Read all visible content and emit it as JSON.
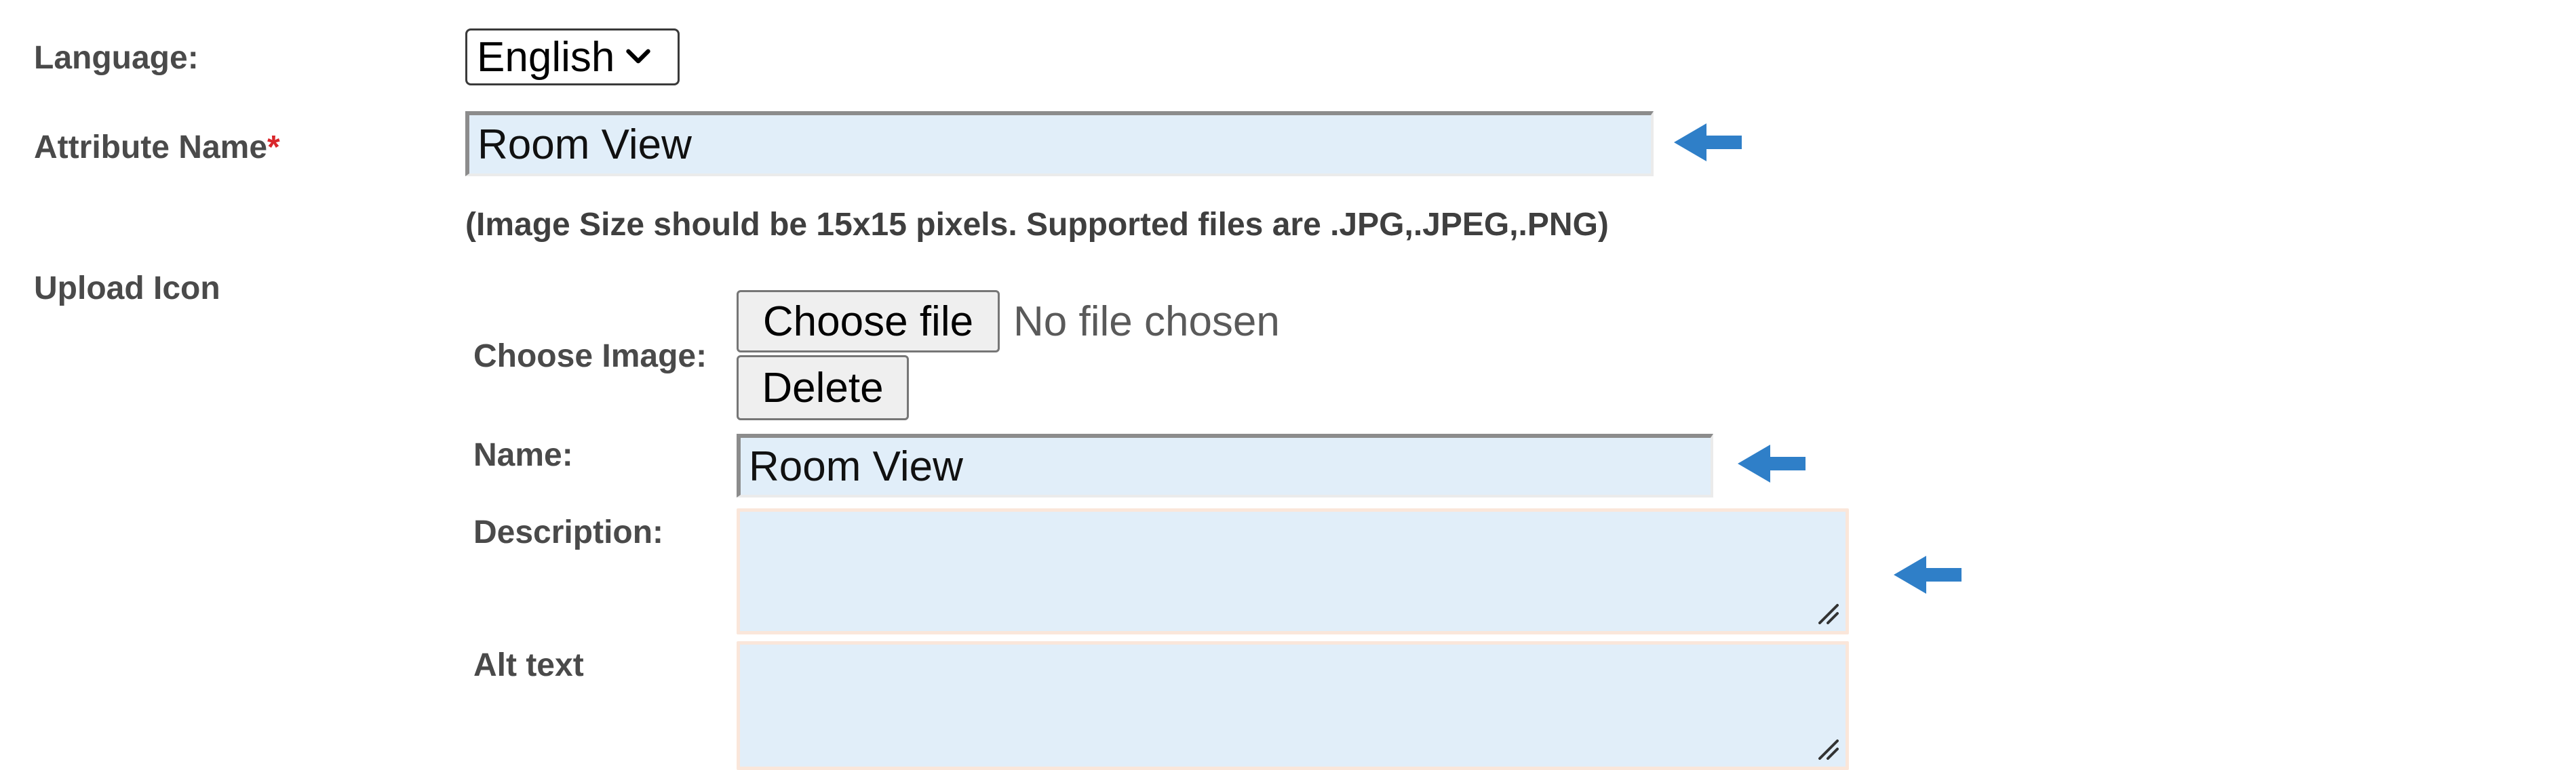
{
  "form": {
    "language": {
      "label": "Language:",
      "selected": "English"
    },
    "attribute_name": {
      "label": "Attribute Name",
      "required_mark": "*",
      "value": "Room View"
    },
    "image_hint": "(Image Size should be 15x15 pixels. Supported files are .JPG,.JPEG,.PNG)",
    "upload_icon": {
      "label": "Upload Icon",
      "choose_image_label": "Choose Image:",
      "choose_file_button": "Choose file",
      "no_file_text": "No file chosen",
      "delete_button": "Delete",
      "name": {
        "label": "Name:",
        "value": "Room View"
      },
      "description": {
        "label": "Description:",
        "value": ""
      },
      "alt_text": {
        "label": "Alt text",
        "value": ""
      }
    }
  },
  "annotations": {
    "arrow_icon": "arrow-left-icon",
    "arrow_color": "#2f7fc8"
  },
  "colors": {
    "field_background": "#e1eef9",
    "label_text": "#4a4a4a",
    "required_mark": "#d9262a"
  }
}
